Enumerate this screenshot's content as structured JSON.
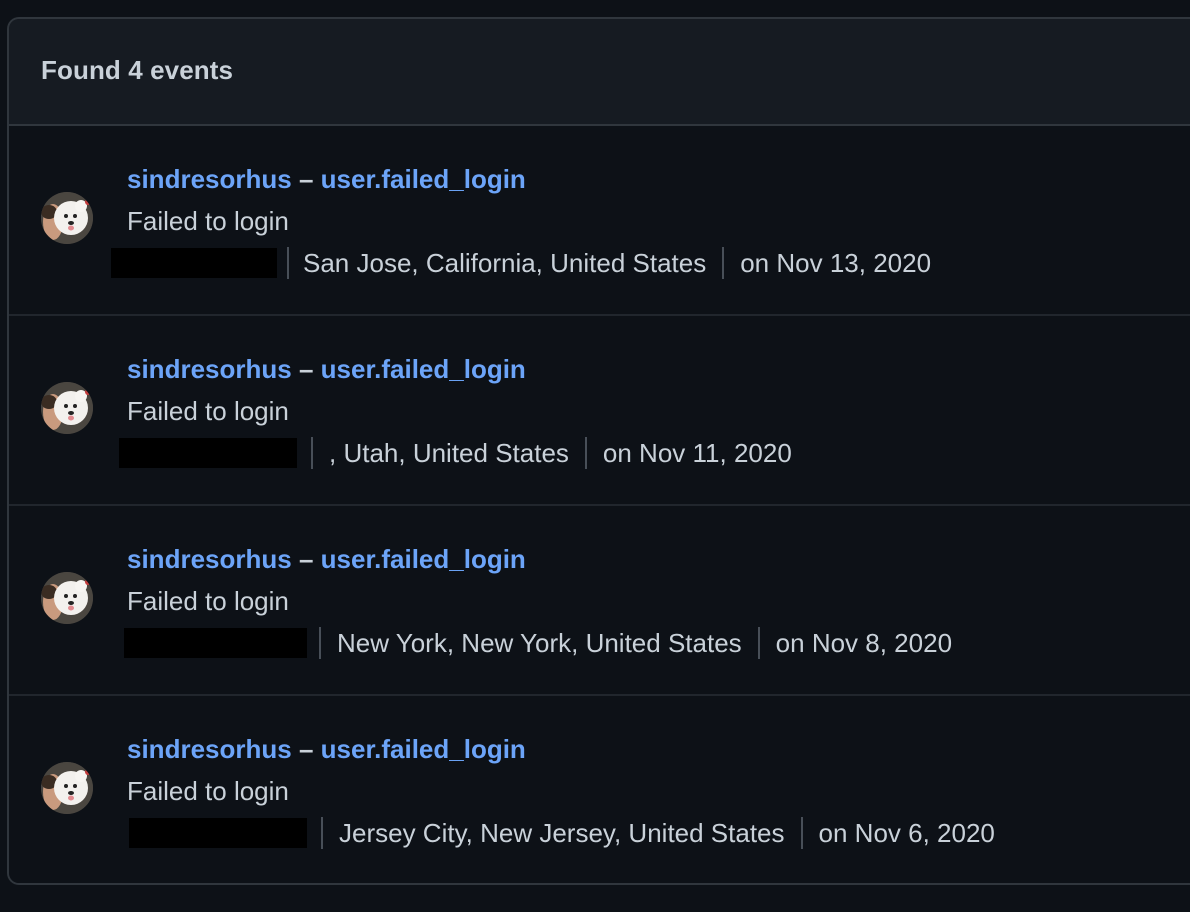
{
  "header": {
    "title": "Found 4 events"
  },
  "events": [
    {
      "user": "sindresorhus",
      "separator": "–",
      "action": "user.failed_login",
      "description": "Failed to login",
      "location": "San Jose, California, United States",
      "date": "on Nov 13, 2020"
    },
    {
      "user": "sindresorhus",
      "separator": "–",
      "action": "user.failed_login",
      "description": "Failed to login",
      "location": ", Utah, United States",
      "date": "on Nov 11, 2020"
    },
    {
      "user": "sindresorhus",
      "separator": "–",
      "action": "user.failed_login",
      "description": "Failed to login",
      "location": "New York, New York, United States",
      "date": "on Nov 8, 2020"
    },
    {
      "user": "sindresorhus",
      "separator": "–",
      "action": "user.failed_login",
      "description": "Failed to login",
      "location": "Jersey City, New Jersey, United States",
      "date": "on Nov 6, 2020"
    }
  ],
  "colors": {
    "background": "#0d1117",
    "panel_header": "#161b22",
    "border": "#30363d",
    "link": "#6ca4f8",
    "text": "#c9d1d9",
    "redaction": "#000000"
  }
}
